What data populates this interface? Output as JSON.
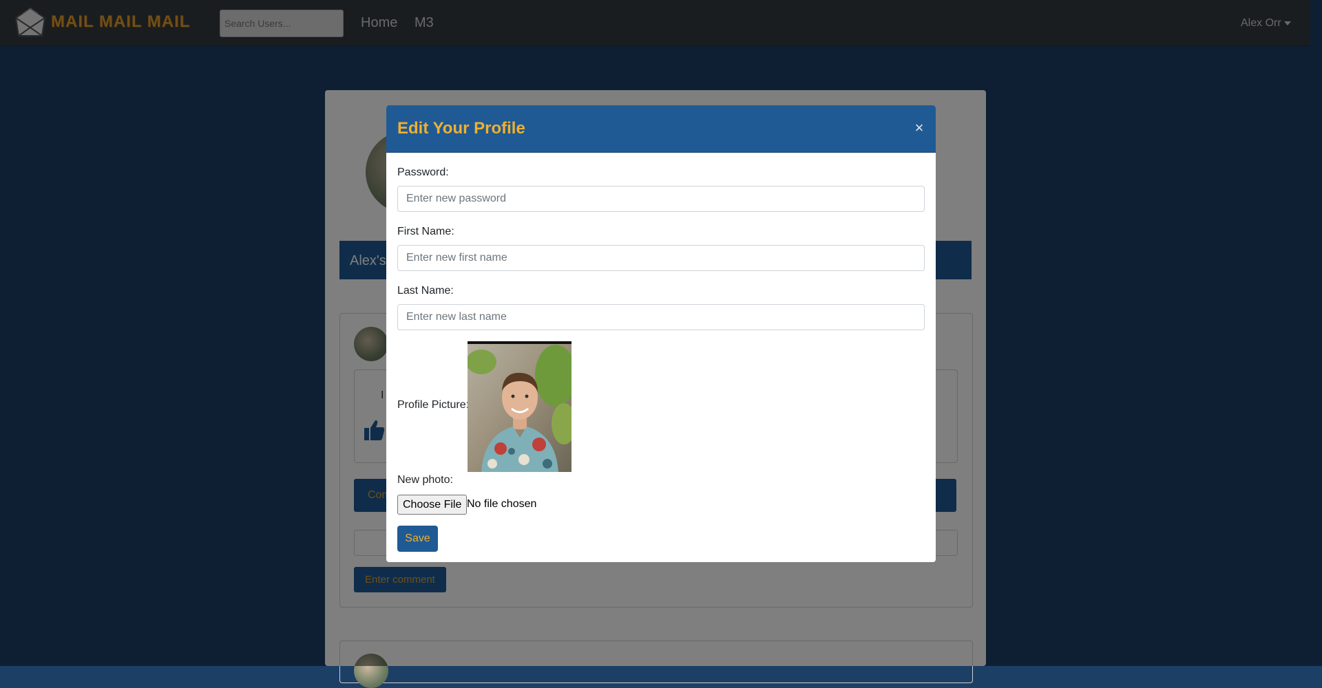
{
  "navbar": {
    "brand": "MAIL MAIL MAIL",
    "search_placeholder": "Search Users...",
    "links": [
      "Home",
      "M3"
    ],
    "user_name": "Alex Orr"
  },
  "background_page": {
    "banner_text": "Alex's",
    "post_fragment": "I",
    "comments_label": "Com",
    "enter_comment_label": "Enter comment"
  },
  "modal": {
    "title": "Edit Your Profile",
    "close_symbol": "×",
    "password_label": "Password:",
    "password_placeholder": "Enter new password",
    "first_name_label": "First Name:",
    "first_name_placeholder": "Enter new first name",
    "last_name_label": "Last Name:",
    "last_name_placeholder": "Enter new last name",
    "profile_picture_label": "Profile Picture:",
    "new_photo_label": "New photo:",
    "choose_file_label": "Choose File",
    "file_status": "No file chosen",
    "save_label": "Save"
  },
  "colors": {
    "page_background": "#1c3f66",
    "navbar": "#343a40",
    "brand": "#e0a030",
    "modal_header": "#1f5a94",
    "accent_text": "#f0b030"
  },
  "icons": [
    "envelope-logo-icon",
    "caret-down-icon",
    "close-icon",
    "thumbs-up-icon"
  ]
}
